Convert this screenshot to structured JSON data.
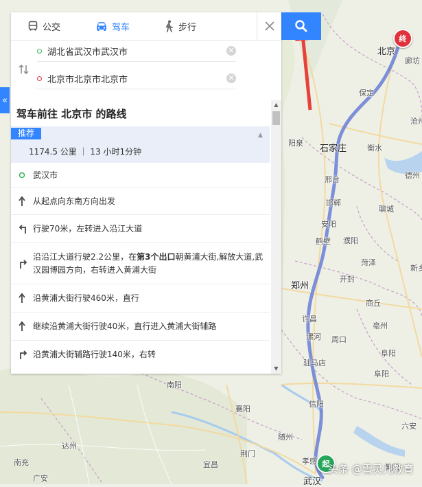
{
  "tabs": [
    {
      "label": "公交",
      "icon": "bus-icon"
    },
    {
      "label": "驾车",
      "icon": "car-icon",
      "active": true
    },
    {
      "label": "步行",
      "icon": "walk-icon"
    }
  ],
  "route_form": {
    "start": "湖北省武汉市武汉市",
    "end": "北京市北京市北京市"
  },
  "collapse_label": "«",
  "route_title": "驾车前往 北京市 的路线",
  "summary": {
    "badge": "推荐",
    "text": "1174.5 公里 ｜ 13 小时1分钟"
  },
  "steps": [
    {
      "icon": "start-circle-icon",
      "text": "武汉市"
    },
    {
      "icon": "arrow-up-icon",
      "text": "从起点向东南方向出发"
    },
    {
      "icon": "turn-left-icon",
      "text": "行驶70米，左转进入沿江大道"
    },
    {
      "icon": "turn-right-icon",
      "text_pre": "沿沿江大道行驶2.2公里，在",
      "text_bold": "第3个出口",
      "text_post": "朝黄浦大街,解放大道,武汉园博园方向，右转进入黄浦大街"
    },
    {
      "icon": "arrow-up-icon",
      "text": "沿黄浦大街行驶460米，直行"
    },
    {
      "icon": "arrow-up-icon",
      "text": "继续沿黄浦大街行驶40米，直行进入黄浦大街辅路"
    },
    {
      "icon": "turn-right-icon",
      "text": "沿黄浦大街辅路行驶140米，右转"
    }
  ],
  "map": {
    "cities": [
      {
        "name": "北京",
        "cls": "big"
      },
      {
        "name": "廊坊",
        "cls": "small"
      },
      {
        "name": "保定",
        "cls": "small"
      },
      {
        "name": "沧州",
        "cls": "small"
      },
      {
        "name": "阳泉",
        "cls": "small"
      },
      {
        "name": "石家庄",
        "cls": "big"
      },
      {
        "name": "衡水",
        "cls": "small"
      },
      {
        "name": "德州",
        "cls": "small"
      },
      {
        "name": "邢台",
        "cls": "small"
      },
      {
        "name": "邯郸",
        "cls": "small"
      },
      {
        "name": "聊城",
        "cls": "small"
      },
      {
        "name": "安阳",
        "cls": "small"
      },
      {
        "name": "鹤壁",
        "cls": "small"
      },
      {
        "name": "濮阳",
        "cls": "small"
      },
      {
        "name": "新乡",
        "cls": "small"
      },
      {
        "name": "菏泽",
        "cls": "small"
      },
      {
        "name": "郑州",
        "cls": "big"
      },
      {
        "name": "开封",
        "cls": "small"
      },
      {
        "name": "商丘",
        "cls": "small"
      },
      {
        "name": "许昌",
        "cls": "small"
      },
      {
        "name": "漯河",
        "cls": "small"
      },
      {
        "name": "周口",
        "cls": "small"
      },
      {
        "name": "亳州",
        "cls": "small"
      },
      {
        "name": "驻马店",
        "cls": "small"
      },
      {
        "name": "阜阳",
        "cls": "small"
      },
      {
        "name": "信阳",
        "cls": "small"
      },
      {
        "name": "襄阳",
        "cls": "small"
      },
      {
        "name": "随州",
        "cls": "small"
      },
      {
        "name": "六安",
        "cls": "small"
      },
      {
        "name": "孝感",
        "cls": "small"
      },
      {
        "name": "荆门",
        "cls": "small"
      },
      {
        "name": "宜昌",
        "cls": "small"
      },
      {
        "name": "达州",
        "cls": "small"
      },
      {
        "name": "南充",
        "cls": "small"
      },
      {
        "name": "广安",
        "cls": "small"
      },
      {
        "name": "武汉",
        "cls": "big"
      },
      {
        "name": "黄冈",
        "cls": "small"
      },
      {
        "name": "阜阳",
        "cls": "small"
      },
      {
        "name": "南阳",
        "cls": "small"
      }
    ],
    "start_marker": "起",
    "end_marker": "终",
    "watermark": "头条 @雪灵儿教育"
  },
  "colors": {
    "accent": "#3385ff",
    "route": "#6f84d6",
    "end_marker": "#e0323a",
    "start_marker": "#26a65b"
  }
}
